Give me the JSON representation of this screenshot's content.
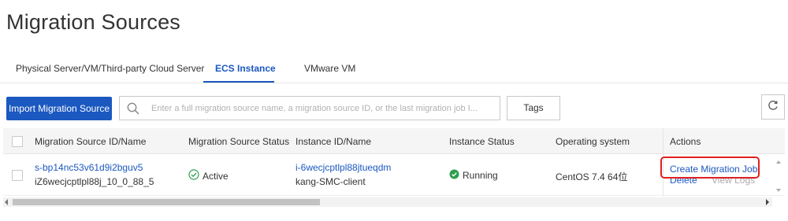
{
  "page": {
    "title": "Migration Sources"
  },
  "tabs": [
    {
      "label": "Physical Server/VM/Third-party Cloud Server",
      "active": false
    },
    {
      "label": "ECS Instance",
      "active": true
    },
    {
      "label": "VMware VM",
      "active": false
    }
  ],
  "toolbar": {
    "import_label": "Import Migration Source",
    "search_placeholder": "Enter a full migration source name, a migration source ID, or the last migration job I...",
    "search_value": "",
    "tags_label": "Tags",
    "refresh_icon": "refresh-icon"
  },
  "table": {
    "columns": [
      "Migration Source ID/Name",
      "Migration Source Status",
      "Instance ID/Name",
      "Instance Status",
      "Operating system",
      "Actions"
    ],
    "rows": [
      {
        "source_id": "s-bp14nc53v61d9i2bguv5",
        "source_name": "iZ6wecjcptlpl88j_10_0_88_5",
        "source_status": "Active",
        "instance_id": "i-6wecjcptlpl88jtueqdm",
        "instance_name": "kang-SMC-client",
        "instance_status": "Running",
        "os": "CentOS 7.4 64位",
        "actions": {
          "create": "Create Migration Job",
          "delete": "Delete",
          "logs": "View Logs"
        }
      }
    ]
  },
  "colors": {
    "primary": "#1b58c0",
    "success": "#2e9e4f",
    "highlight": "#e02020"
  }
}
